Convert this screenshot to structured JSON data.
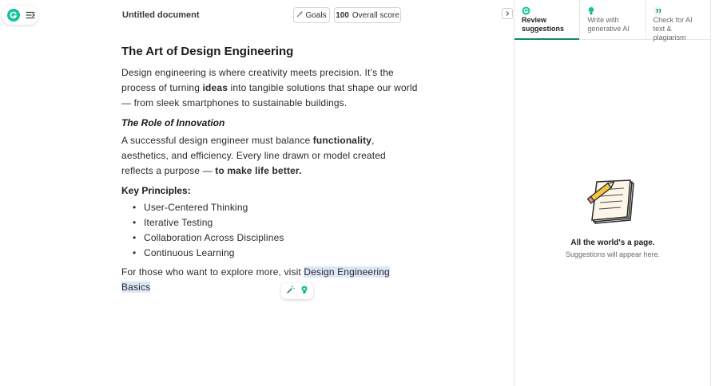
{
  "header": {
    "doc_title": "Untitled document",
    "goals_label": "Goals",
    "score_value": "100",
    "score_label": "Overall score"
  },
  "document": {
    "title": "The Art of Design Engineering",
    "p1": {
      "part1": "Design engineering is where creativity meets precision. It’s the process of turning ",
      "bold": "ideas",
      "part2": " into tangible solutions that shape our world — from sleek smartphones to sustainable buildings."
    },
    "h2": "The Role of Innovation",
    "p2": {
      "part1": "A successful design engineer must balance ",
      "bold1": "functionality",
      "part2": ", aesthetics, and efficiency. Every line drawn or model created reflects a purpose — ",
      "bold2": "to make life better."
    },
    "h3": "Key Principles:",
    "principles": [
      "User-Centered Thinking",
      "Iterative Testing",
      "Collaboration Across Disciplines",
      "Continuous Learning"
    ],
    "p3": {
      "part1": "For those who want to explore more, visit ",
      "link": "Design Engineering Basics"
    }
  },
  "sidebar": {
    "tabs": [
      {
        "line1": "Review",
        "line2": "suggestions",
        "icon": "grammarly-g-icon"
      },
      {
        "line1": "Write with",
        "line2": "generative AI",
        "icon": "bulb-icon"
      },
      {
        "line1": "Check for AI",
        "line2": "text & plagiarism",
        "icon": "quote-icon"
      }
    ],
    "empty_title": "All the world's a page.",
    "empty_subtitle": "Suggestions will appear here."
  },
  "colors": {
    "brand": "#15c39a",
    "active_tab": "#0f8a6a",
    "highlight": "#dce8f5"
  }
}
